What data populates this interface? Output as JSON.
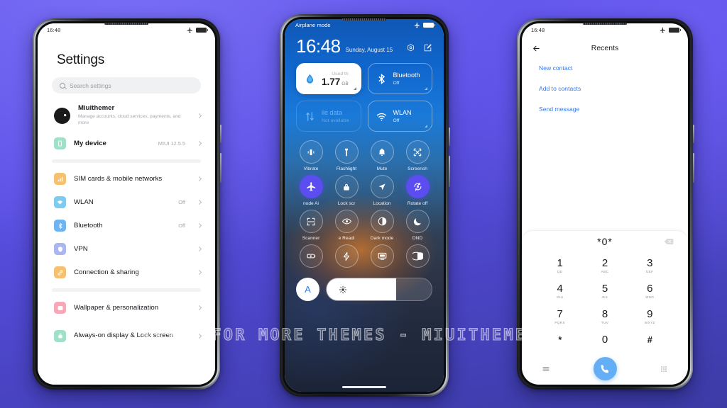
{
  "watermark": "VISIT FOR MORE THEMES - MIUITHEMER.COM",
  "colors": {
    "background_top": "#6257ef",
    "background_bottom": "#3c3ba6",
    "accent_purple": "#5b4df0",
    "link_blue": "#3478f0",
    "call_green_blue": "#64aef5"
  },
  "phone1": {
    "status": {
      "time": "16:48",
      "airplane_icon": "airplane-icon",
      "battery_icon": "battery-icon"
    },
    "title": "Settings",
    "search": {
      "placeholder": "Search settings",
      "icon": "search-icon"
    },
    "account": {
      "name": "Miuithemer",
      "subtitle": "Manage accounts, cloud services, payments, and more"
    },
    "items": [
      {
        "label": "My device",
        "value": "MIUI 12.5.5",
        "icon": "phone-icon",
        "color": "#9fe0c8"
      },
      {
        "label": "SIM cards & mobile networks",
        "value": "",
        "icon": "signal-bars-icon",
        "color": "#f5c070"
      },
      {
        "label": "WLAN",
        "value": "Off",
        "icon": "wifi-icon",
        "color": "#7ecbf0"
      },
      {
        "label": "Bluetooth",
        "value": "Off",
        "icon": "bluetooth-icon",
        "color": "#6fb4f2"
      },
      {
        "label": "VPN",
        "value": "",
        "icon": "vpn-shield-icon",
        "color": "#a9b6f2"
      },
      {
        "label": "Connection & sharing",
        "value": "",
        "icon": "link-icon",
        "color": "#f5c070"
      },
      {
        "label": "Wallpaper & personalization",
        "value": "",
        "icon": "wallpaper-icon",
        "color": "#f6a8b8"
      },
      {
        "label": "Always-on display & Lock screen",
        "value": "",
        "icon": "lock-icon",
        "color": "#9fe0c8"
      }
    ]
  },
  "phone2": {
    "status": {
      "label": "Airplane mode",
      "airplane_icon": "airplane-icon",
      "battery_icon": "battery-icon"
    },
    "clock": {
      "time": "16:48",
      "date": "Sunday, August 15"
    },
    "header_icons": [
      "settings-gear-icon",
      "edit-pencil-icon"
    ],
    "big_tiles": [
      {
        "id": "data-usage",
        "state": "on",
        "icon": "water-drop-icon",
        "top_label": "Used th",
        "value": "1.77",
        "unit": "GB"
      },
      {
        "id": "bluetooth",
        "state": "off",
        "icon": "bluetooth-icon",
        "title": "Bluetooth",
        "sub": "Off"
      },
      {
        "id": "mobile-data",
        "state": "disabled",
        "icon": "data-arrows-icon",
        "title": "ile data",
        "sub": "Not available"
      },
      {
        "id": "wlan",
        "state": "off",
        "icon": "wifi-icon",
        "title": "WLAN",
        "sub": "Off"
      }
    ],
    "toggles": [
      {
        "label": "Vibrate",
        "icon": "vibrate-icon",
        "active": false
      },
      {
        "label": "Flashlight",
        "icon": "flashlight-icon",
        "active": false
      },
      {
        "label": "Mute",
        "icon": "bell-icon",
        "active": false
      },
      {
        "label": "Screensh",
        "icon": "screenshot-icon",
        "active": false
      },
      {
        "label": "node     Ai",
        "icon": "airplane-icon",
        "active": true
      },
      {
        "label": "Lock scr",
        "icon": "padlock-icon",
        "active": false
      },
      {
        "label": "Location",
        "icon": "location-arrow-icon",
        "active": false
      },
      {
        "label": "Rotate off",
        "icon": "rotate-lock-icon",
        "active": true
      },
      {
        "label": "Scanner",
        "icon": "scan-frame-icon",
        "active": false
      },
      {
        "label": "e   Readi",
        "icon": "eye-icon",
        "active": false
      },
      {
        "label": "Dark mode",
        "icon": "contrast-circle-icon",
        "active": false
      },
      {
        "label": "DND",
        "icon": "moon-icon",
        "active": false
      },
      {
        "label": "",
        "icon": "battery-saver-icon",
        "active": false
      },
      {
        "label": "",
        "icon": "lightning-icon",
        "active": false
      },
      {
        "label": "",
        "icon": "cast-screen-icon",
        "active": false
      },
      {
        "label": "",
        "icon": "half-moon-contrast-icon",
        "active": false
      }
    ],
    "brightness": {
      "auto_label": "A",
      "icon": "sun-icon",
      "level_percent": 66
    }
  },
  "phone3": {
    "status": {
      "time": "16:48",
      "airplane_icon": "airplane-icon",
      "battery_icon": "battery-icon"
    },
    "nav": {
      "back_icon": "back-arrow-icon",
      "title": "Recents"
    },
    "links": [
      "New contact",
      "Add to contacts",
      "Send message"
    ],
    "entry": {
      "value": "*0*",
      "delete_icon": "backspace-icon"
    },
    "keys": [
      {
        "digit": "1",
        "letters": "QD"
      },
      {
        "digit": "2",
        "letters": "ABC"
      },
      {
        "digit": "3",
        "letters": "DEF"
      },
      {
        "digit": "4",
        "letters": "GHI"
      },
      {
        "digit": "5",
        "letters": "JKL"
      },
      {
        "digit": "6",
        "letters": "MNO"
      },
      {
        "digit": "7",
        "letters": "PQRS"
      },
      {
        "digit": "8",
        "letters": "TUV"
      },
      {
        "digit": "9",
        "letters": "WXYZ"
      },
      {
        "digit": "*",
        "letters": ""
      },
      {
        "digit": "0",
        "letters": ""
      },
      {
        "digit": "#",
        "letters": ""
      }
    ],
    "actions": {
      "left_icon": "menu-lines-icon",
      "call_icon": "phone-call-icon",
      "right_icon": "keypad-grid-icon"
    }
  }
}
